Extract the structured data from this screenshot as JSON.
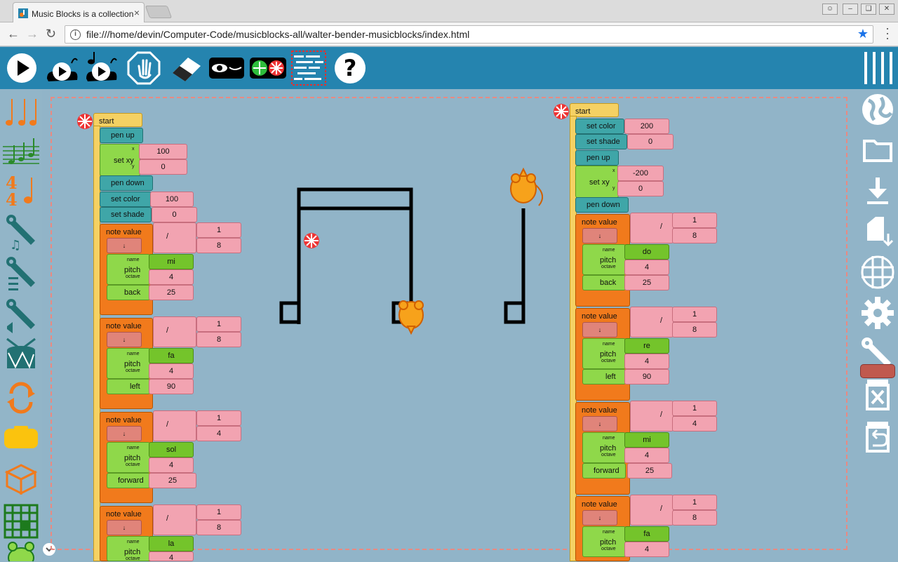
{
  "browser": {
    "tab_title": "Music Blocks is a collection",
    "close_glyph": "×",
    "address": "file:///home/devin/Computer-Code/musicblocks-all/walter-bender-musicblocks/index.html"
  },
  "toolbar": {
    "buttons": [
      "play-icon",
      "slow-play-icon",
      "step-icon",
      "stop-icon",
      "eraser-icon",
      "hide-blocks-icon",
      "collapse-icon",
      "block-menu-icon",
      "help-icon"
    ]
  },
  "colors": {
    "toolbar": "#2584af",
    "canvas": "#91b4c8",
    "note_value": "#f17a1c",
    "pitch": "#8fd84a",
    "pen": "#3fa6a8",
    "number": "#f2a3b1",
    "start": "#f5d163",
    "mouse": "#f7a21b"
  },
  "left_stack": {
    "start": "start",
    "pen_up": "pen up",
    "set_xy": "set xy",
    "set_xy_x_label": "x",
    "set_xy_y_label": "y",
    "set_xy_x": "100",
    "set_xy_y": "0",
    "pen_down": "pen down",
    "set_color": "set color",
    "set_color_val": "100",
    "set_shade": "set shade",
    "set_shade_val": "0",
    "notes": [
      {
        "label": "note value",
        "div": "/",
        "num": "1",
        "den": "8",
        "arrow": "↓",
        "name_lbl": "name",
        "pitch": "pitch",
        "octave_lbl": "octave",
        "note": "mi",
        "octave": "4",
        "move": "back",
        "move_val": "25"
      },
      {
        "label": "note value",
        "div": "/",
        "num": "1",
        "den": "8",
        "arrow": "↓",
        "name_lbl": "name",
        "pitch": "pitch",
        "octave_lbl": "octave",
        "note": "fa",
        "octave": "4",
        "move": "left",
        "move_val": "90"
      },
      {
        "label": "note value",
        "div": "/",
        "num": "1",
        "den": "4",
        "arrow": "↓",
        "name_lbl": "name",
        "pitch": "pitch",
        "octave_lbl": "octave",
        "note": "sol",
        "octave": "4",
        "move": "forward",
        "move_val": "25"
      },
      {
        "label": "note value",
        "div": "/",
        "num": "1",
        "den": "8",
        "arrow": "↓",
        "name_lbl": "name",
        "pitch": "pitch",
        "octave_lbl": "octave",
        "note": "la",
        "octave": "4"
      }
    ]
  },
  "right_stack": {
    "start": "start",
    "set_color": "set color",
    "set_color_val": "200",
    "set_shade": "set shade",
    "set_shade_val": "0",
    "pen_up": "pen up",
    "set_xy": "set xy",
    "set_xy_x_label": "x",
    "set_xy_y_label": "y",
    "set_xy_x": "-200",
    "set_xy_y": "0",
    "pen_down": "pen down",
    "notes": [
      {
        "label": "note value",
        "div": "/",
        "num": "1",
        "den": "8",
        "arrow": "↓",
        "name_lbl": "name",
        "pitch": "pitch",
        "octave_lbl": "octave",
        "note": "do",
        "octave": "4",
        "move": "back",
        "move_val": "25"
      },
      {
        "label": "note value",
        "div": "/",
        "num": "1",
        "den": "8",
        "arrow": "↓",
        "name_lbl": "name",
        "pitch": "pitch",
        "octave_lbl": "octave",
        "note": "re",
        "octave": "4",
        "move": "left",
        "move_val": "90"
      },
      {
        "label": "note value",
        "div": "/",
        "num": "1",
        "den": "4",
        "arrow": "↓",
        "name_lbl": "name",
        "pitch": "pitch",
        "octave_lbl": "octave",
        "note": "mi",
        "octave": "4",
        "move": "forward",
        "move_val": "25"
      },
      {
        "label": "note value",
        "div": "/",
        "num": "1",
        "den": "8",
        "arrow": "↓",
        "name_lbl": "name",
        "pitch": "pitch",
        "octave_lbl": "octave",
        "note": "fa",
        "octave": "4"
      }
    ]
  }
}
